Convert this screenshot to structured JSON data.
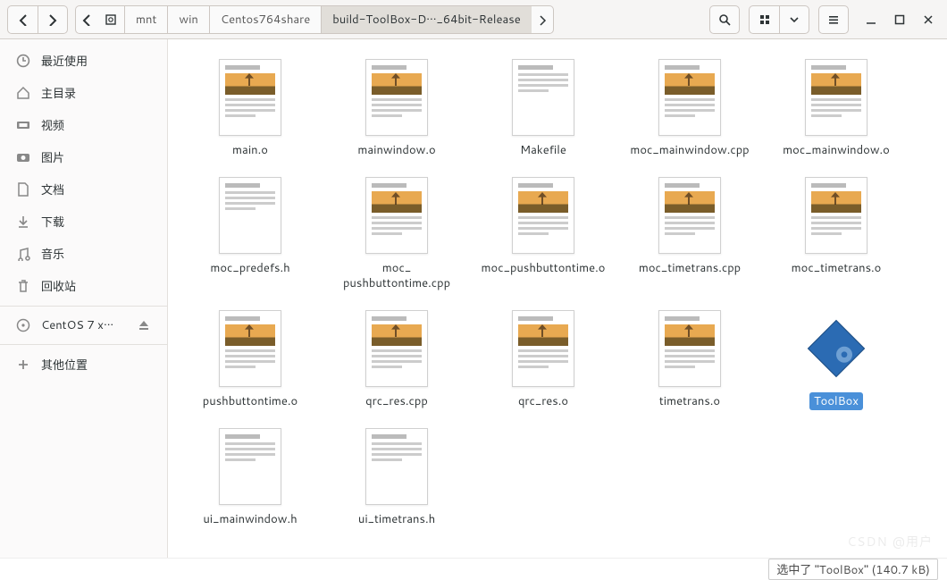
{
  "path": {
    "segments": [
      "mnt",
      "win",
      "Centos764share",
      "build-ToolBox-D···_64bit-Release"
    ],
    "active_index": 3
  },
  "sidebar": {
    "items": [
      {
        "id": "recent",
        "label": "最近使用",
        "icon": "clock"
      },
      {
        "id": "home",
        "label": "主目录",
        "icon": "home"
      },
      {
        "id": "videos",
        "label": "视频",
        "icon": "video"
      },
      {
        "id": "pictures",
        "label": "图片",
        "icon": "camera"
      },
      {
        "id": "documents",
        "label": "文档",
        "icon": "file"
      },
      {
        "id": "downloads",
        "label": "下载",
        "icon": "download"
      },
      {
        "id": "music",
        "label": "音乐",
        "icon": "music"
      },
      {
        "id": "trash",
        "label": "回收站",
        "icon": "trash"
      }
    ],
    "volume": {
      "label": "CentOS 7 x···",
      "icon": "disc",
      "ejectable": true
    },
    "other": {
      "label": "其他位置",
      "icon": "plus"
    }
  },
  "files": [
    {
      "name": "main.o",
      "type": "obj"
    },
    {
      "name": "mainwindow.o",
      "type": "obj"
    },
    {
      "name": "Makefile",
      "type": "text"
    },
    {
      "name": "moc_mainwindow.cpp",
      "type": "src"
    },
    {
      "name": "moc_mainwindow.o",
      "type": "obj"
    },
    {
      "name": "moc_predefs.h",
      "type": "hdr"
    },
    {
      "name": "moc_pushbuttontime.cpp",
      "type": "src"
    },
    {
      "name": "moc_pushbuttontime.o",
      "type": "obj"
    },
    {
      "name": "moc_timetrans.cpp",
      "type": "src"
    },
    {
      "name": "moc_timetrans.o",
      "type": "obj"
    },
    {
      "name": "pushbuttontime.o",
      "type": "obj"
    },
    {
      "name": "qrc_res.cpp",
      "type": "src"
    },
    {
      "name": "qrc_res.o",
      "type": "obj"
    },
    {
      "name": "timetrans.o",
      "type": "obj"
    },
    {
      "name": "ToolBox",
      "type": "exec",
      "selected": true
    },
    {
      "name": "ui_mainwindow.h",
      "type": "hdr"
    },
    {
      "name": "ui_timetrans.h",
      "type": "hdr"
    }
  ],
  "status": "选中了 \"ToolBox\" (140.7 kB)",
  "icons": {
    "clock": "clock",
    "home": "home",
    "video": "video",
    "camera": "camera",
    "file": "file",
    "download": "download",
    "music": "music",
    "trash": "trash",
    "disc": "disc",
    "plus": "plus"
  }
}
